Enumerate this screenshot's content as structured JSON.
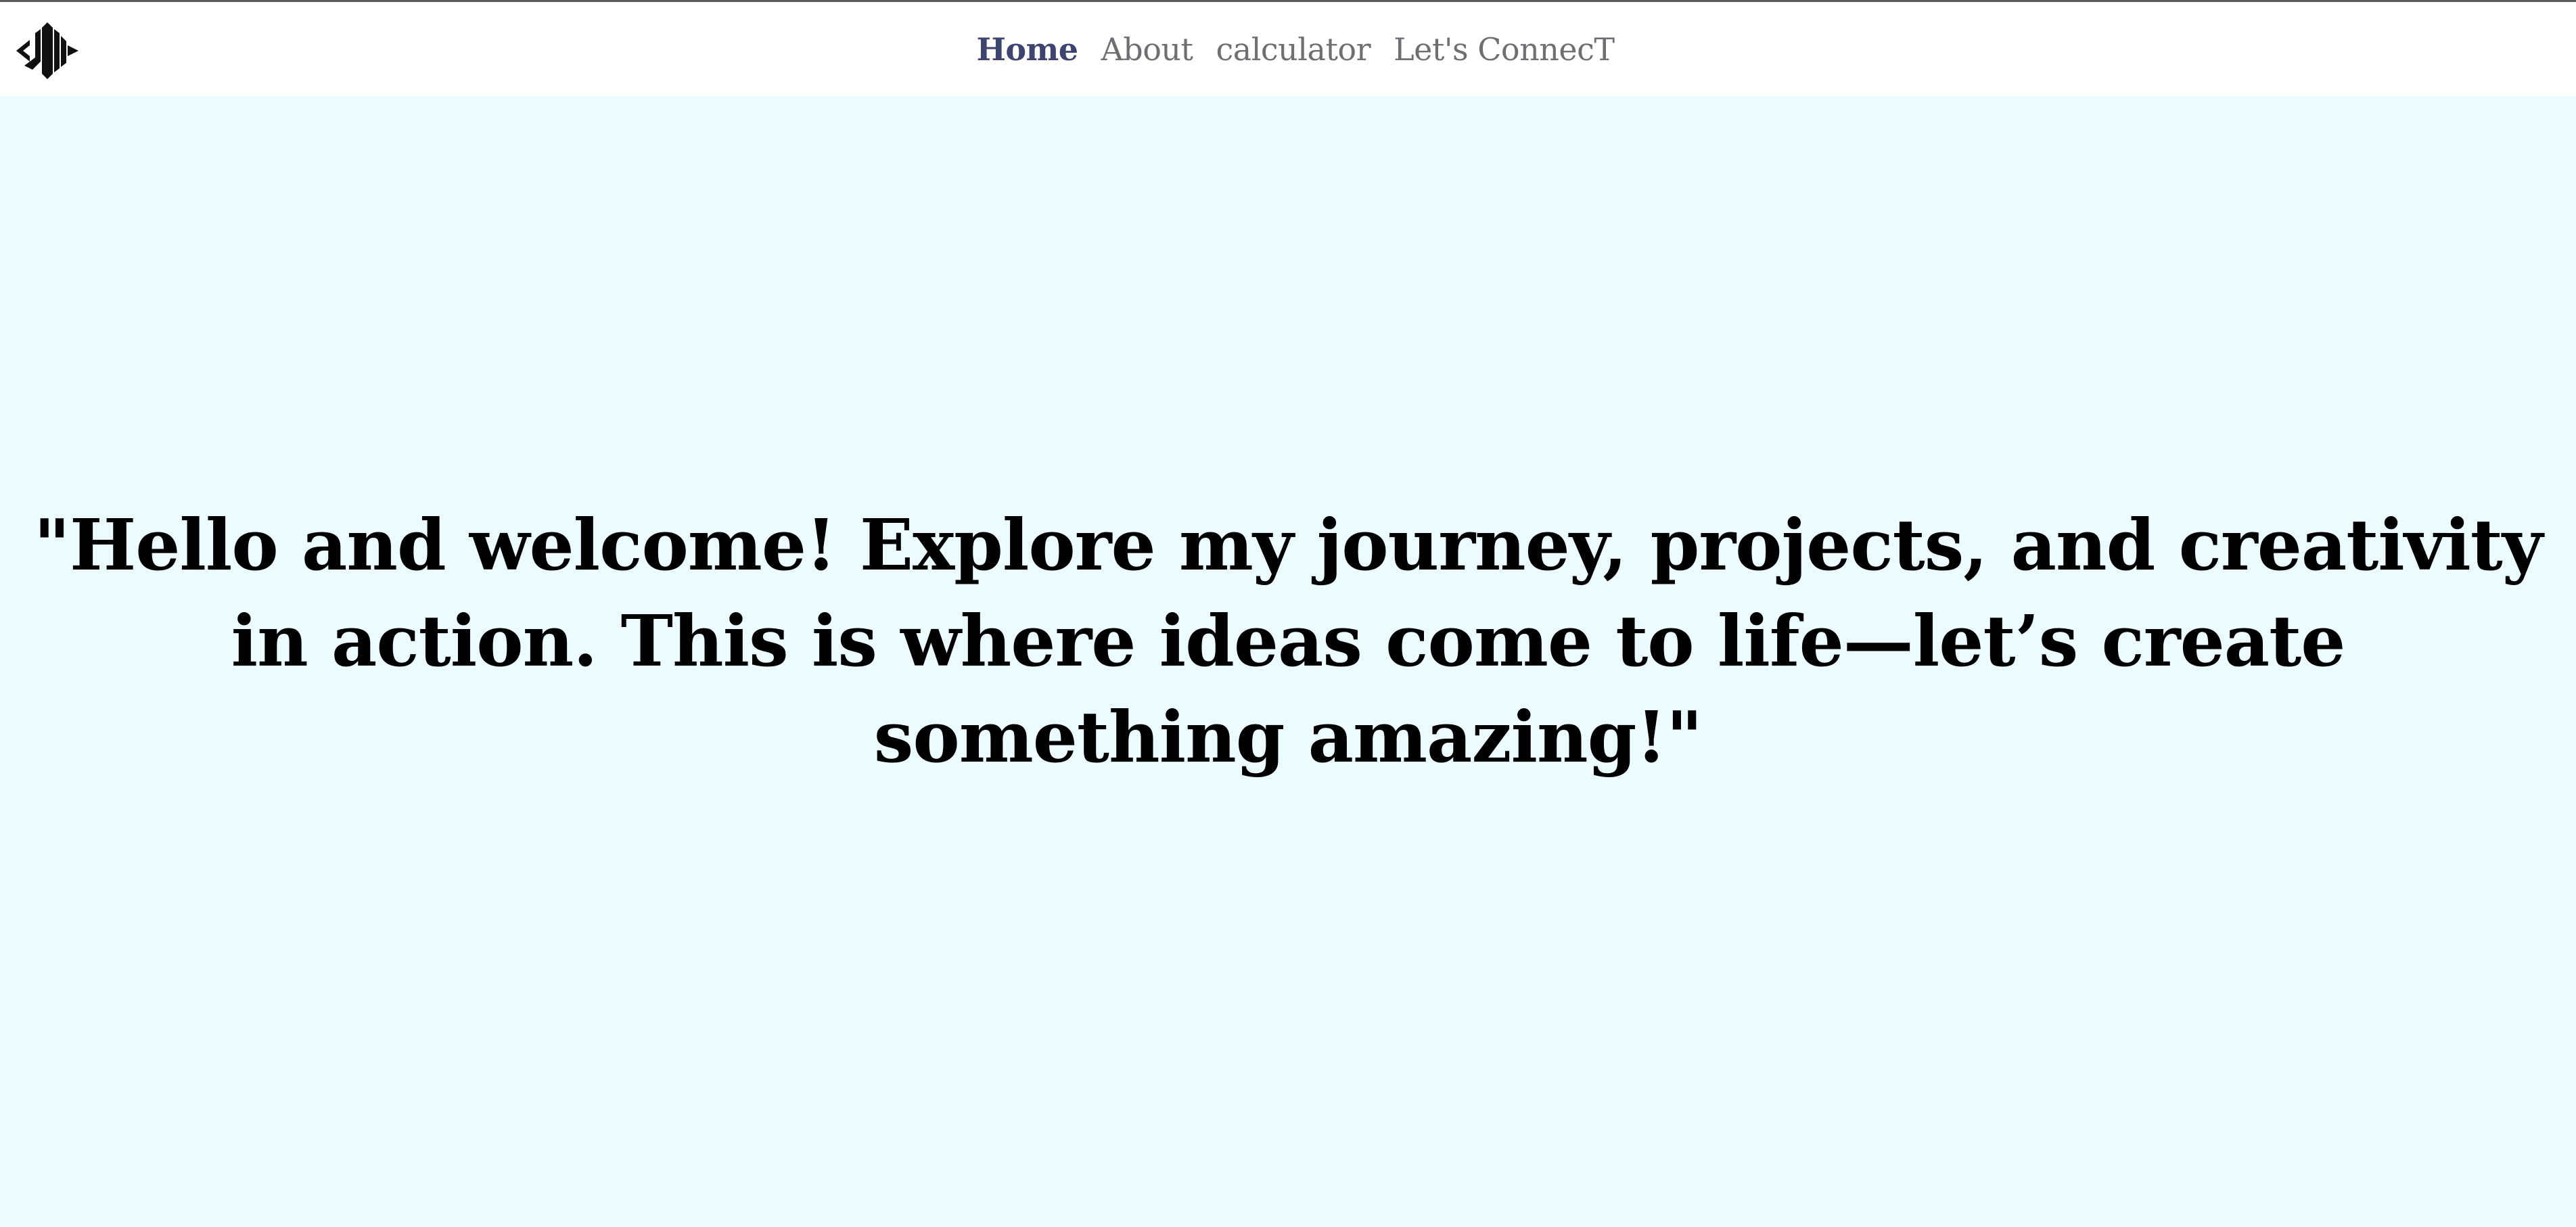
{
  "nav": {
    "logo_icon": "jm-monogram-logo-icon",
    "links": [
      {
        "label": "Home",
        "active": true
      },
      {
        "label": "About",
        "active": false
      },
      {
        "label": "calculator",
        "active": false
      },
      {
        "label": "Let's ConnecT",
        "active": false
      }
    ]
  },
  "hero": {
    "text": "\"Hello and welcome! Explore my journey, projects, and creativity in action. This is where ideas come to life—let’s create something amazing!\""
  },
  "colors": {
    "page_background": "#ebfbff",
    "navbar_background": "#ffffff",
    "nav_active": "#3d4470",
    "nav_inactive": "#6e6e73",
    "hero_text": "#000000"
  }
}
